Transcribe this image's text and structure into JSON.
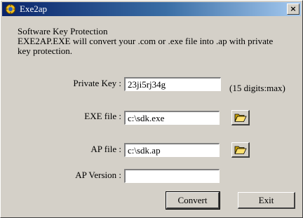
{
  "window": {
    "title": "Exe2ap",
    "close_label": "×"
  },
  "description": {
    "line1": "Software Key Protection",
    "line2": "EXE2AP.EXE will convert your .com or .exe file into .ap with private",
    "line3": "key protection."
  },
  "form": {
    "private_key": {
      "label": "Private Key :",
      "value": "23ji5rj34g",
      "hint": "(15 digits:max)"
    },
    "exe_file": {
      "label": "EXE file :",
      "value": "c:\\sdk.exe",
      "browse_icon": "folder-open-icon"
    },
    "ap_file": {
      "label": "AP file :",
      "value": "c:\\sdk.ap",
      "browse_icon": "folder-open-icon"
    },
    "ap_version": {
      "label": "AP Version :",
      "value": ""
    }
  },
  "buttons": {
    "convert": "Convert",
    "exit": "Exit"
  },
  "colors": {
    "titlebar_start": "#0a246a",
    "titlebar_end": "#a6caf0",
    "dialog_bg": "#d4d0c8"
  }
}
